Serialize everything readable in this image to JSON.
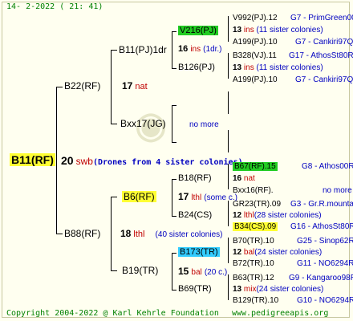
{
  "header": "14- 2-2022 ( 21: 41)",
  "footer": {
    "copyright": "Copyright 2004-2022 @ Karl Kehrle Foundation",
    "site": "www.pedigreeapis.org"
  },
  "root": {
    "id": "B11(RF)",
    "gen": "20",
    "breed": "swb",
    "note": "(Drones from 4 sister colonies)"
  },
  "sire_side": {
    "id": "B22(RF)",
    "mother": {
      "id": "B11(PJ)1dr",
      "gen": "17",
      "breed": "nat"
    },
    "m1": {
      "id": "V216(PJ)",
      "gen": "16",
      "breed": "ins",
      "note": "(1dr.)"
    },
    "m1a": {
      "id": "V992(PJ).12",
      "line": "G7 - PrimGreen00"
    },
    "m1b": {
      "gen": "13",
      "breed": "ins",
      "note": "(11 sister colonies)"
    },
    "m1c": {
      "id": "A199(PJ).10",
      "line": "G7 - Cankiri97Q"
    },
    "m2": {
      "id": "B126(PJ)"
    },
    "m2a": {
      "id": "B328(VJ).11",
      "line": "G17 - AthosSt80R"
    },
    "m2b": {
      "gen": "13",
      "breed": "ins",
      "note": "(11 sister colonies)"
    },
    "m2c": {
      "id": "A199(PJ).10",
      "line": "G7 - Cankiri97Q"
    },
    "f": {
      "id": "Bxx17(JG)",
      "note": "no more"
    }
  },
  "dam_side": {
    "id": "B88(RF)",
    "gen": "18",
    "breed": "lthl",
    "note": "(40 sister colonies)",
    "upper": {
      "id": "B6(RF)",
      "gen": "17",
      "breed": "lthl",
      "note": "(some c.)"
    },
    "u1": {
      "id": "B18(RF)"
    },
    "u1a": {
      "id": "B67(RF).15",
      "line": "G8 - Athos00R"
    },
    "u1b": {
      "gen": "16",
      "breed": "nat"
    },
    "u1c": {
      "id": "Bxx16(RF).",
      "note": "no more"
    },
    "u2": {
      "id": "B24(CS)"
    },
    "u2a": {
      "id": "GR23(TR).09",
      "line": "G3 - Gr.R.mounta"
    },
    "u2b": {
      "gen": "12",
      "breed": "lthl",
      "note": "(28 sister colonies)"
    },
    "u2c": {
      "id": "B34(CS).09",
      "line": "G16 - AthosSt80R"
    },
    "lower": {
      "id": "B19(TR)"
    },
    "l1": {
      "id": "B173(TR)",
      "gen": "15",
      "breed": "bal",
      "note": "(20 c.)"
    },
    "l1a": {
      "id": "B70(TR).10",
      "line": "G25 - Sinop62R"
    },
    "l1b": {
      "gen": "12",
      "breed": "bal",
      "note": "(24 sister colonies)"
    },
    "l1c": {
      "id": "B72(TR).10",
      "line": "G11 - NO6294R"
    },
    "l2": {
      "id": "B69(TR)"
    },
    "l2a": {
      "id": "B63(TR).12",
      "line": "G9 - Kangaroo98R"
    },
    "l2b": {
      "gen": "13",
      "breed": "mix",
      "note": "(24 sister colonies)"
    },
    "l2c": {
      "id": "B129(TR).10",
      "line": "G10 - NO6294R"
    }
  }
}
